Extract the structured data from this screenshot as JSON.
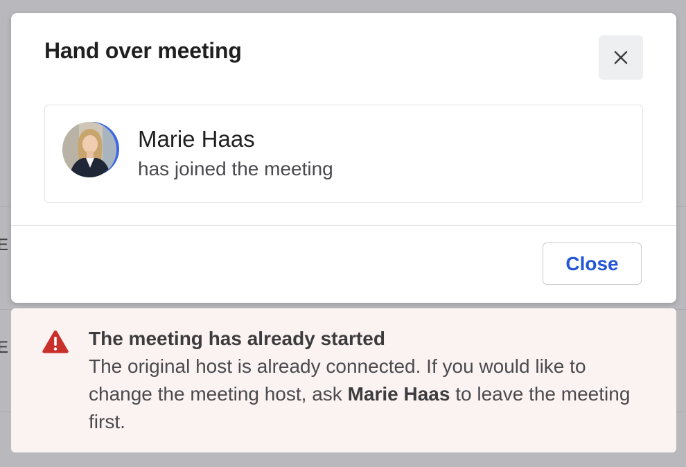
{
  "dialog": {
    "title": "Hand over meeting",
    "close_icon": "close-icon"
  },
  "participant": {
    "name": "Marie Haas",
    "status": "has joined the meeting",
    "avatar": "avatar-photo",
    "ring_color": "#3b66e6"
  },
  "footer": {
    "close_label": "Close",
    "accent_color": "#2456d6"
  },
  "alert": {
    "icon": "warning-triangle-icon",
    "icon_color": "#c9302c",
    "title": "The meeting has already started",
    "body_before": "The original host is already connected. If you would like to change the meeting host, ask ",
    "body_bold": "Marie Haas",
    "body_after": " to leave the meeting first.",
    "background_color": "#fbf3f1"
  }
}
